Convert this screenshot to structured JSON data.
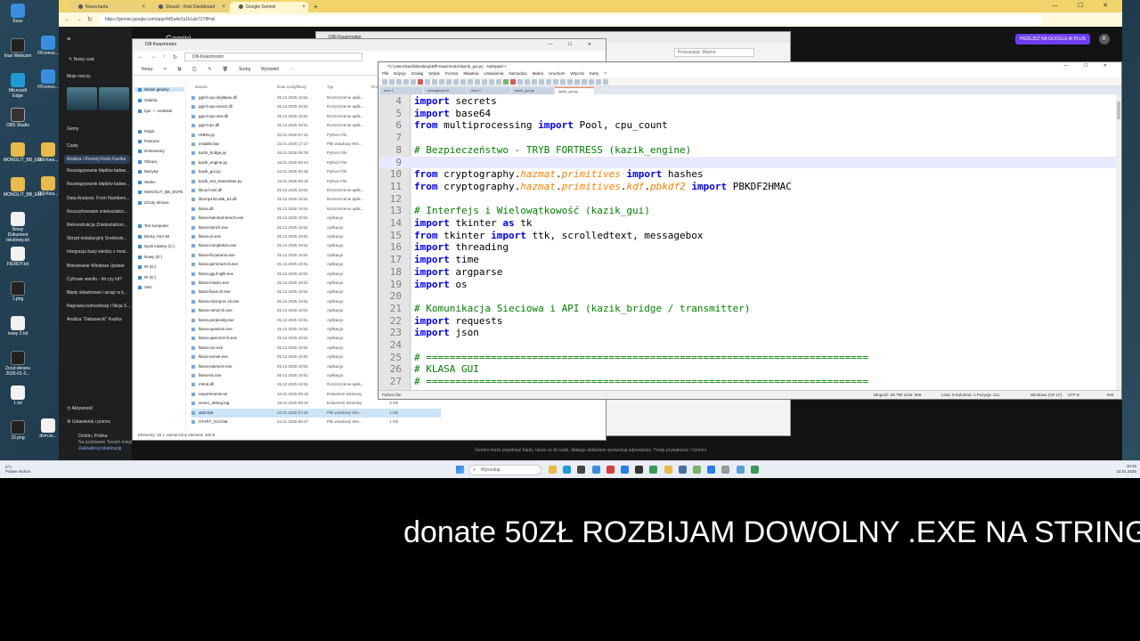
{
  "desktop": {
    "icons": [
      {
        "label": "Kosz",
        "kind": "app"
      },
      {
        "label": "Iriun Webcam",
        "kind": "cam"
      },
      {
        "label": "Microsoft Edge",
        "kind": "edge"
      },
      {
        "label": "OBS Studio",
        "kind": "obs"
      },
      {
        "label": "MONOLIT_BB_EN...",
        "kind": "folder"
      },
      {
        "label": "MONOLIT_BB_EN...",
        "kind": "folder"
      },
      {
        "label": "Nowy Dokument tekstowy.txt",
        "kind": "doc"
      },
      {
        "label": "FIERDY.txt",
        "kind": "doc"
      },
      {
        "label": "1.png",
        "kind": "cam"
      },
      {
        "label": "nowy 2.txt",
        "kind": "doc"
      },
      {
        "label": "Zrzut ekranu 2026-01-2...",
        "kind": "cam"
      },
      {
        "label": "1.txt",
        "kind": "doc"
      },
      {
        "label": "15.png",
        "kind": "cam"
      }
    ],
    "icons_col2": [
      {
        "label": "FFconvo...",
        "kind": "app"
      },
      {
        "label": "FFconvo...",
        "kind": "app"
      },
      {
        "label": "Dlll-Kwa...",
        "kind": "folder"
      },
      {
        "label": "Dlll-Kwa...",
        "kind": "folder"
      },
      {
        "label": "dvm.to...",
        "kind": "doc"
      }
    ]
  },
  "browser": {
    "tabs": [
      {
        "label": "Nowa karta",
        "active": false
      },
      {
        "label": "Strusiń - Kick Dashboard",
        "active": false
      },
      {
        "label": "Google Gemini",
        "active": true
      }
    ],
    "url": "https://gemini.google.com/app/4d5a4e2a1b1ab7278f=pl",
    "window_controls": "— ☐ ✕"
  },
  "gemini": {
    "title": "Gemini",
    "upgrade_label": "PRZEJDŹ NA GOOGLE AI PLUS",
    "avatar": "K",
    "sidebar": {
      "menu_icon": "≡",
      "new_chat": "Nowy czat",
      "my_stuff": "Moje rzeczy",
      "gems": "Gemy",
      "chats": "Czaty",
      "chat_items": [
        "Analiza i Rozwój Kodu Kazika",
        "Rozwiązywanie błędów ładow...",
        "Rozwiązywanie błędów ładow...",
        "Data Analysis: From Numbers...",
        "Rozszyfrowanie zniekształco...",
        "Rekonstrukcja Zniekształcon...",
        "Skrypt instalacyjny Środowis...",
        "Integracja bazy wiedzy z mod...",
        "Blokowanie Windows Update",
        "Cyfrowe wiertło - hit czy kit?",
        "Błędy składniowe i wciąć w k...",
        "Naprawa komunikacji i Nicja S...",
        "Analiza \"Zabawecki\" Kazika"
      ],
      "activity": "Aktywność",
      "settings": "Ustawienia i pomoc",
      "location_line1": "Drobin, Polska",
      "location_line2": "Na podstawie Twoich miejsc (Dom)",
      "location_line3": "Zaktualizuj lokalizację"
    },
    "footer": "Gemini może popełniać błędy, także co do ludzi, dlatego dokładnie sprawdzaj odpowiedzi. Twoja prywatność i Gemini"
  },
  "explorer_back": {
    "title": "DllII-Kwazmrator",
    "search_placeholder": "Przeszukaj: Ważne"
  },
  "explorer": {
    "title": "Dlll-Kwazmrator",
    "path": "Dlll-Kwazmrator",
    "toolbar": [
      "Nowy",
      "✂",
      "⧉",
      "📋",
      "✎",
      "🗑",
      "Sortuj",
      "Wyświetl",
      "···"
    ],
    "columns": [
      "Nazwa",
      "Data modyfikacji",
      "Typ",
      "Rozmiar"
    ],
    "sidebar": [
      {
        "label": "Widok główny",
        "sel": true
      },
      {
        "label": "Galeria",
        "sel": false
      },
      {
        "label": "Igor — osobiste",
        "sel": false
      },
      {
        "label": "Pulpit",
        "sel": false
      },
      {
        "label": "Pobrane",
        "sel": false
      },
      {
        "label": "Dokumenty",
        "sel": false
      },
      {
        "label": "Obrazy",
        "sel": false
      },
      {
        "label": "Muzyka",
        "sel": false
      },
      {
        "label": "Wideo",
        "sel": false
      },
      {
        "label": "MONOLIT_BB_ENTE",
        "sel": false
      },
      {
        "label": "Zrzuty ekranu",
        "sel": false
      },
      {
        "label": "Ten komputer",
        "sel": false
      },
      {
        "label": "Dielcy ASA 50",
        "sel": false
      },
      {
        "label": "Dysk lokalny (C:)",
        "sel": false
      },
      {
        "label": "Nowy (D:)",
        "sel": false
      },
      {
        "label": "IR (D:)",
        "sel": false
      },
      {
        "label": "IR (E:)",
        "sel": false
      },
      {
        "label": "Sieć",
        "sel": false
      }
    ],
    "files": [
      {
        "name": "ggml-cpu-skylakex.dll",
        "date": "25.12.2025 19:51",
        "type": "Rozszerzenie aplik...",
        "size": "7"
      },
      {
        "name": "ggml-cpu-sse42.dll",
        "date": "25.12.2025 19:51",
        "type": "Rozszerzenie aplik...",
        "size": "7"
      },
      {
        "name": "ggml-cpu-x64.dll",
        "date": "25.12.2025 19:51",
        "type": "Rozszerzenie aplik...",
        "size": "7"
      },
      {
        "name": "ggml-rpc.dll",
        "date": "25.12.2025 19:51",
        "type": "Rozszerzenie aplik...",
        "size": "7"
      },
      {
        "name": "HIBIN.py",
        "date": "20.01.2026 07:46",
        "type": "Python File",
        "size": "3"
      },
      {
        "name": "installer.bat",
        "date": "15.01.2026 17:17",
        "type": "Plik wsadowy Win...",
        "size": "1"
      },
      {
        "name": "kazik_bridge.py",
        "date": "16.01.2026 09:29",
        "type": "Python File",
        "size": "1"
      },
      {
        "name": "kazik_engine.py",
        "date": "16.01.2026 09:44",
        "type": "Python File",
        "size": "2"
      },
      {
        "name": "kazik_gui.py",
        "date": "22.01.2026 06:38",
        "type": "Python File",
        "size": "1"
      },
      {
        "name": "kazik_net_transmitter.py",
        "date": "16.01.2026 09:19",
        "type": "Python File",
        "size": "2"
      },
      {
        "name": "libcurl-x64.dll",
        "date": "25.12.2025 19:51",
        "type": "Rozszerzenie aplik...",
        "size": "3"
      },
      {
        "name": "libomp140.x86_64.dll",
        "date": "25.12.2025 19:51",
        "type": "Rozszerzenie aplik...",
        "size": "2"
      },
      {
        "name": "llama.dll",
        "date": "25.12.2025 19:51",
        "type": "Rozszerzenie aplik...",
        "size": "2.42"
      },
      {
        "name": "llama-batched-bench.exe",
        "date": "25.12.2025 19:51",
        "type": "Aplikacja",
        "size": "3"
      },
      {
        "name": "llama-bench.exe",
        "date": "25.12.2025 19:51",
        "type": "Aplikacja",
        "size": "3"
      },
      {
        "name": "llama-cli.exe",
        "date": "25.12.2025 19:51",
        "type": "Aplikacja",
        "size": "3"
      },
      {
        "name": "llama-completion.exe",
        "date": "25.12.2025 19:51",
        "type": "Aplikacja",
        "size": "3"
      },
      {
        "name": "llama-fit-params.exe",
        "date": "25.12.2025 19:51",
        "type": "Aplikacja",
        "size": "3"
      },
      {
        "name": "llama-gemma3-cli.exe",
        "date": "25.12.2025 19:51",
        "type": "Aplikacja",
        "size": "3"
      },
      {
        "name": "llama-gguf-split.exe",
        "date": "25.12.2025 19:51",
        "type": "Aplikacja",
        "size": "3"
      },
      {
        "name": "llama-imatrix.exe",
        "date": "25.12.2025 19:51",
        "type": "Aplikacja",
        "size": "3"
      },
      {
        "name": "llama-llava-cli.exe",
        "date": "25.12.2025 19:51",
        "type": "Aplikacja",
        "size": "3"
      },
      {
        "name": "llama-minicpmv-cli.exe",
        "date": "25.12.2025 19:51",
        "type": "Aplikacja",
        "size": "3"
      },
      {
        "name": "llama-mtmd-cli.exe",
        "date": "25.12.2025 19:51",
        "type": "Aplikacja",
        "size": "3"
      },
      {
        "name": "llama-perplexity.exe",
        "date": "25.12.2025 19:51",
        "type": "Aplikacja",
        "size": "3"
      },
      {
        "name": "llama-quantize.exe",
        "date": "25.12.2025 19:51",
        "type": "Aplikacja",
        "size": "3"
      },
      {
        "name": "llama-qwen2vl-cli.exe",
        "date": "25.12.2025 19:51",
        "type": "Aplikacja",
        "size": "3"
      },
      {
        "name": "llama-run.exe",
        "date": "25.12.2025 19:51",
        "type": "Aplikacja",
        "size": "3"
      },
      {
        "name": "llama-server.exe",
        "date": "25.12.2025 19:51",
        "type": "Aplikacja",
        "size": "3"
      },
      {
        "name": "llama-tokenize.exe",
        "date": "25.12.2025 19:51",
        "type": "Aplikacja",
        "size": "3"
      },
      {
        "name": "llama-tts.exe",
        "date": "25.12.2025 19:51",
        "type": "Aplikacja",
        "size": "3"
      },
      {
        "name": "mtmd.dll",
        "date": "25.12.2025 19:51",
        "type": "Rozszerzenie aplik...",
        "size": "3"
      },
      {
        "name": "requirements.txt",
        "date": "16.01.2026 09:19",
        "type": "Dokument tekstowy",
        "size": "1 KB"
      },
      {
        "name": "seven_debug.log",
        "date": "18.01.2026 09:29",
        "type": "Dokument tekstowy",
        "size": "2 KB"
      },
      {
        "name": "start.bat",
        "date": "15.01.2026 07:26",
        "type": "Plik wsadowy Win...",
        "size": "1 KB",
        "sel": true
      },
      {
        "name": "START_GUI.bat",
        "date": "22.01.2026 06:37",
        "type": "Plik wsadowy Win...",
        "size": "1 KB"
      }
    ],
    "status": "Elementy: 46    1 zaznaczony element: 420 B"
  },
  "notepad": {
    "title": "*C:\\Users\\kazik\\Desktop\\Dlll-Kwazmrator\\kazik_gui.py - Notepad++",
    "menu": [
      "Plik",
      "Edycja",
      "Szukaj",
      "Widok",
      "Format",
      "Składnia",
      "Ustawienia",
      "Narzędzia",
      "Makra",
      "Uruchom",
      "Wtyczki",
      "Karty",
      "?"
    ],
    "tabs": [
      {
        "label": "new 1",
        "active": false
      },
      {
        "label": "changelog.txt",
        "active": false
      },
      {
        "label": "new 2",
        "active": false
      },
      {
        "label": "kazik_gui.py",
        "active": false
      },
      {
        "label": "kazik_gui.py",
        "active": true
      }
    ],
    "lines": [
      {
        "n": "4",
        "text": "import secrets",
        "kind": "import"
      },
      {
        "n": "5",
        "text": "import base64",
        "kind": "import"
      },
      {
        "n": "6",
        "text": "from multiprocessing import Pool, cpu_count",
        "kind": "from"
      },
      {
        "n": "7",
        "text": "",
        "kind": "blank"
      },
      {
        "n": "8",
        "text": "# Bezpieczeństwo - TRYB FORTRESS (kazik_engine)",
        "kind": "comment"
      },
      {
        "n": "9",
        "text": "",
        "kind": "cursor"
      },
      {
        "n": "10",
        "text": "from cryptography.hazmat.primitives import hashes",
        "kind": "crypto1"
      },
      {
        "n": "11",
        "text": "from cryptography.hazmat.primitives.kdf.pbkdf2 import PBKDF2HMAC",
        "kind": "crypto2"
      },
      {
        "n": "12",
        "text": "",
        "kind": "blank"
      },
      {
        "n": "13",
        "text": "# Interfejs i Wielowątkowość (kazik_gui)",
        "kind": "comment"
      },
      {
        "n": "14",
        "text": "import tkinter as tk",
        "kind": "import_as"
      },
      {
        "n": "15",
        "text": "from tkinter import ttk, scrolledtext, messagebox",
        "kind": "from"
      },
      {
        "n": "16",
        "text": "import threading",
        "kind": "import"
      },
      {
        "n": "17",
        "text": "import time",
        "kind": "import"
      },
      {
        "n": "18",
        "text": "import argparse",
        "kind": "import"
      },
      {
        "n": "19",
        "text": "import os",
        "kind": "import"
      },
      {
        "n": "20",
        "text": "",
        "kind": "blank"
      },
      {
        "n": "21",
        "text": "# Komunikacja Sieciowa i API (kazik_bridge / transmitter)",
        "kind": "comment"
      },
      {
        "n": "22",
        "text": "import requests",
        "kind": "import"
      },
      {
        "n": "23",
        "text": "import json",
        "kind": "import"
      },
      {
        "n": "24",
        "text": "",
        "kind": "blank"
      },
      {
        "n": "25",
        "text": "# ===========================================================================",
        "kind": "comment"
      },
      {
        "n": "26",
        "text": "# KLASA GUI",
        "kind": "comment"
      },
      {
        "n": "27",
        "text": "# ===========================================================================",
        "kind": "comment"
      }
    ],
    "status": {
      "lang": "Python file",
      "length": "Długość: 25 790    Linie: 566",
      "pos": "Linia: 9    Kolumna: 1    Pozycja: 211",
      "eol": "Windows (CR LF)",
      "enc": "UTF-8",
      "ins": "INS"
    }
  },
  "taskbar": {
    "weather_line1": "0°C",
    "weather_line2": "Prawie słońce.",
    "search_placeholder": "Wyszukaj",
    "clock_time": "18:46",
    "clock_date": "22.01.2026"
  },
  "caption": "donate  50ZŁ ROZBIJAM DOWOLNY .EXE NA STRINGI"
}
